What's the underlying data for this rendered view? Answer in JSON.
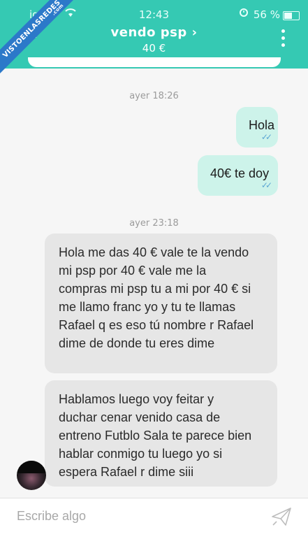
{
  "status_bar": {
    "carrier": "igo",
    "time": "12:43",
    "battery": "56 %"
  },
  "watermark": {
    "text": "VISTOENLASREDES",
    "suffix": ".com"
  },
  "header": {
    "title": "vendo psp",
    "title_chevron": "›",
    "price": "40 €",
    "back_icon": "back-arrow-icon",
    "menu_icon": "more-vertical-icon"
  },
  "chat": {
    "timestamps": [
      "ayer 18:26",
      "ayer 23:18"
    ],
    "outgoing": [
      {
        "text": "Hola",
        "status": "read"
      },
      {
        "text": "40€ te doy",
        "status": "read"
      }
    ],
    "incoming": [
      {
        "text": "Hola me das 40 € vale te la vendo\nmi psp por 40 € vale me la\ncompras mi psp tu a mi por 40 € si\nme llamo franc yo y tu te llamas\nRafael q es eso tú nombre r Rafael\ndime de donde tu eres dime"
      },
      {
        "text": "Hablamos luego voy feitar y\nduchar cenar venido casa de\nentreno Futblo Sala te parece bien\nhablar conmigo tu luego yo si\nespera Rafael r dime siii"
      }
    ]
  },
  "composer": {
    "placeholder": "Escribe algo",
    "send_icon": "send-icon"
  },
  "colors": {
    "header": "#35c9b3",
    "outgoing_bubble": "#cdf3ea",
    "incoming_bubble": "#e6e6e6",
    "read_ticks": "#5ba6d4"
  }
}
